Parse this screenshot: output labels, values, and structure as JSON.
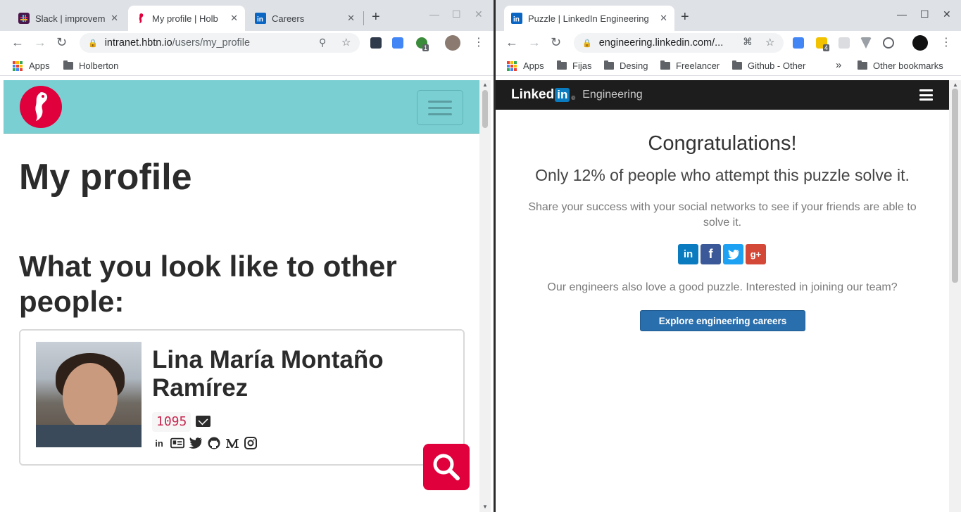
{
  "left_window": {
    "tabs": [
      {
        "title": "Slack | improvem",
        "active": false
      },
      {
        "title": "My profile | Holb",
        "active": true
      },
      {
        "title": "Careers",
        "active": false
      }
    ],
    "url": {
      "host": "intranet.hbtn.io",
      "path": "/users/my_profile"
    },
    "ext_badge": "1",
    "bookmarks": [
      "Apps",
      "Holberton"
    ],
    "page": {
      "heading": "My profile",
      "subheading": "What you look like to other people:",
      "profile_name": "Lina María Montaño Ramírez",
      "profile_id": "1095"
    }
  },
  "right_window": {
    "tabs": [
      {
        "title": "Puzzle | LinkedIn Engineering",
        "active": true
      }
    ],
    "url": {
      "host": "engineering.linkedin.com/..."
    },
    "ext_badge": "4",
    "bookmarks": [
      "Apps",
      "Fijas",
      "Desing",
      "Freelancer",
      "Github - Other"
    ],
    "overflow_label": "»",
    "other_bookmarks": "Other bookmarks",
    "page": {
      "logo_linked": "Linked",
      "logo_in": "in",
      "logo_reg": "®",
      "logo_suffix": "Engineering",
      "congrats": "Congratulations!",
      "percent_text": "Only 12% of people who attempt this puzzle solve it.",
      "share_text": "Share your success with your social networks to see if your friends are able to solve it.",
      "share_icons": [
        "linkedin",
        "facebook",
        "twitter",
        "google-plus"
      ],
      "join_text": "Our engineers also love a good puzzle. Interested in joining our team?",
      "careers_button": "Explore engineering careers"
    }
  },
  "colors": {
    "holberton_red": "#e0003c",
    "holberton_teal": "#7acfd3",
    "linkedin_blue": "#0b7bc0",
    "careers_button": "#2a6fad",
    "code_pink": "#c7254e"
  }
}
